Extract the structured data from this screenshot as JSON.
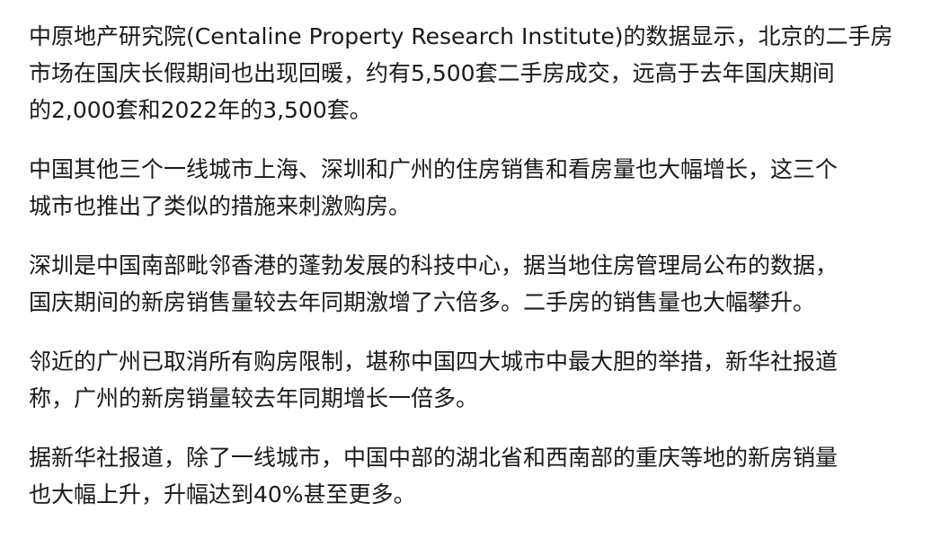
{
  "article": {
    "paragraphs": [
      {
        "lines": [
          "中原地产研究院(Centaline Property Research Institute)的数据显示，北京的二手房",
          "市场在国庆长假期间也出现回暖，约有5,500套二手房成交，远高于去年国庆期间",
          "的2,000套和2022年的3,500套。"
        ]
      },
      {
        "lines": [
          "中国其他三个一线城市上海、深圳和广州的住房销售和看房量也大幅增长，这三个",
          "城市也推出了类似的措施来刺激购房。"
        ]
      },
      {
        "lines": [
          "深圳是中国南部毗邻香港的蓬勃发展的科技中心，据当地住房管理局公布的数据，",
          "国庆期间的新房销售量较去年同期激增了六倍多。二手房的销售量也大幅攀升。"
        ]
      },
      {
        "lines": [
          "邻近的广州已取消所有购房限制，堪称中国四大城市中最大胆的举措，新华社报道",
          "称，广州的新房销量较去年同期增长一倍多。"
        ]
      },
      {
        "lines": [
          "据新华社报道，除了一线城市，中国中部的湖北省和西南部的重庆等地的新房销量",
          "也大幅上升，升幅达到40%甚至更多。"
        ]
      }
    ]
  }
}
